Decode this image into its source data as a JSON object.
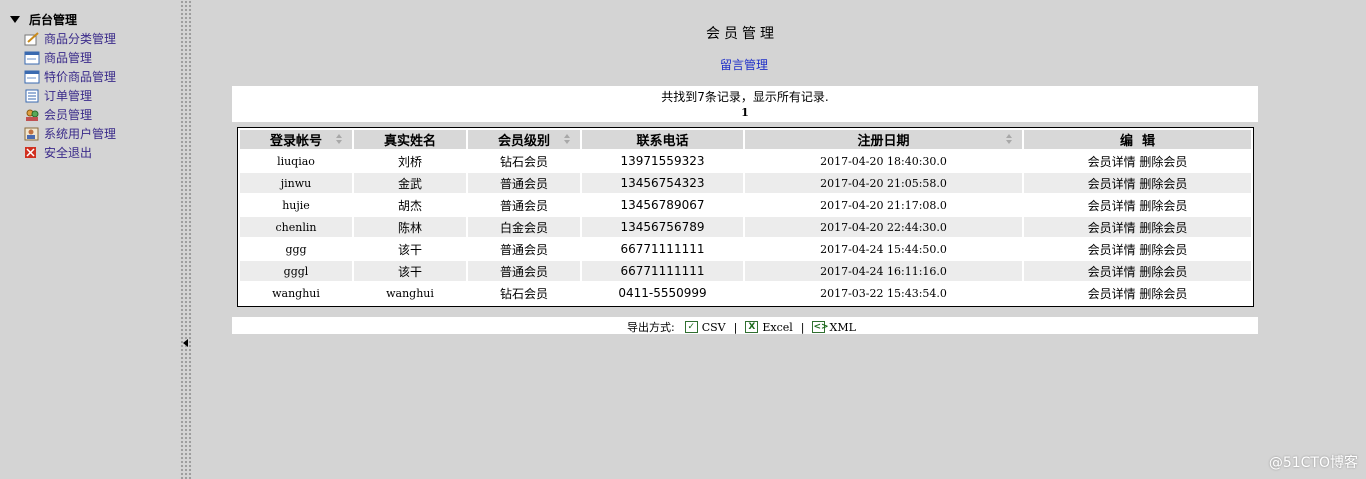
{
  "sidebar": {
    "title": "后台管理",
    "items": [
      {
        "label": "商品分类管理",
        "icon": "pencil-doc-icon"
      },
      {
        "label": "商品管理",
        "icon": "window-icon"
      },
      {
        "label": "特价商品管理",
        "icon": "window-icon"
      },
      {
        "label": "订单管理",
        "icon": "list-doc-icon"
      },
      {
        "label": "会员管理",
        "icon": "users-icon"
      },
      {
        "label": "系统用户管理",
        "icon": "user-card-icon"
      },
      {
        "label": "安全退出",
        "icon": "close-box-icon"
      }
    ]
  },
  "main": {
    "title": "会员管理",
    "message_link": "留言管理",
    "record_summary": "共找到7条记录，显示所有记录.",
    "page_number": "1",
    "columns": [
      "登录帐号",
      "真实姓名",
      "会员级别",
      "联系电话",
      "注册日期",
      "编  辑"
    ],
    "sortable": [
      true,
      false,
      true,
      false,
      true,
      false
    ],
    "rows": [
      {
        "account": "liuqiao",
        "name": "刘桥",
        "level": "钻石会员",
        "phone": "13971559323",
        "date": "2017-04-20 18:40:30.0"
      },
      {
        "account": "jinwu",
        "name": "金武",
        "level": "普通会员",
        "phone": "13456754323",
        "date": "2017-04-20 21:05:58.0"
      },
      {
        "account": "hujie",
        "name": "胡杰",
        "level": "普通会员",
        "phone": "13456789067",
        "date": "2017-04-20 21:17:08.0"
      },
      {
        "account": "chenlin",
        "name": "陈林",
        "level": "白金会员",
        "phone": "13456756789",
        "date": "2017-04-20 22:44:30.0"
      },
      {
        "account": "ggg",
        "name": "该干",
        "level": "普通会员",
        "phone": "66771111111",
        "date": "2017-04-24 15:44:50.0"
      },
      {
        "account": "gggl",
        "name": "该干",
        "level": "普通会员",
        "phone": "66771111111",
        "date": "2017-04-24 16:11:16.0"
      },
      {
        "account": "wanghui",
        "name": "wanghui",
        "level": "钻石会员",
        "phone": "0411-5550999",
        "date": "2017-03-22 15:43:54.0"
      }
    ],
    "actions": {
      "detail": "会员详情",
      "delete": "删除会员"
    },
    "export": {
      "label": "导出方式:",
      "options": [
        {
          "label": "CSV",
          "icon": "csv-icon"
        },
        {
          "label": "Excel",
          "icon": "excel-icon"
        },
        {
          "label": "XML",
          "icon": "xml-icon"
        }
      ],
      "separator": "|"
    }
  },
  "watermark": "@51CTO博客",
  "colors": {
    "link_blue": "#1f2fc8",
    "menu_text": "#3a2a8a",
    "background": "#d4d4d4",
    "row_alt": "#ececec"
  }
}
